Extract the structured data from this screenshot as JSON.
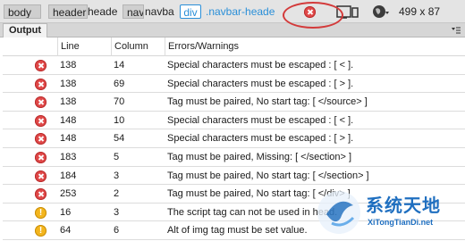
{
  "breadcrumb": {
    "items": [
      "body",
      "header",
      "heade",
      "nav",
      "navba",
      "div",
      ".navbar-header"
    ]
  },
  "status": {
    "error_icon": "error-icon",
    "viewport_size": "499 x 87",
    "device_icon": "device-preview-icon",
    "globe_icon": "browser-preview-icon",
    "highlight_color": "#d33a3a"
  },
  "panel": {
    "tab_label": "Output",
    "menu_icon": "panel-menu-icon"
  },
  "table": {
    "columns": [
      "Line",
      "Column",
      "Errors/Warnings"
    ],
    "rows": [
      {
        "type": "error",
        "line": "138",
        "column": "14",
        "message": "Special characters must be escaped : [ < ]."
      },
      {
        "type": "error",
        "line": "138",
        "column": "69",
        "message": "Special characters must be escaped : [ > ]."
      },
      {
        "type": "error",
        "line": "138",
        "column": "70",
        "message": "Tag must be paired, No start tag: [ </source> ]"
      },
      {
        "type": "error",
        "line": "148",
        "column": "10",
        "message": "Special characters must be escaped : [ < ]."
      },
      {
        "type": "error",
        "line": "148",
        "column": "54",
        "message": "Special characters must be escaped : [ > ]."
      },
      {
        "type": "error",
        "line": "183",
        "column": "5",
        "message": "Tag must be paired, Missing: [ </section> ]"
      },
      {
        "type": "error",
        "line": "184",
        "column": "3",
        "message": "Tag must be paired, No start tag: [ </section> ]"
      },
      {
        "type": "error",
        "line": "253",
        "column": "2",
        "message": "Tag must be paired, No start tag: [ </div> ]"
      },
      {
        "type": "warning",
        "line": "16",
        "column": "3",
        "message": "The script tag can not be used in head."
      },
      {
        "type": "warning",
        "line": "64",
        "column": "6",
        "message": "Alt of img tag must be set value."
      }
    ],
    "colors": {
      "error": "#e04848",
      "warning": "#f3b51d"
    }
  },
  "watermark": {
    "name": "系统天地",
    "url": "XiTongTianDi.net"
  }
}
